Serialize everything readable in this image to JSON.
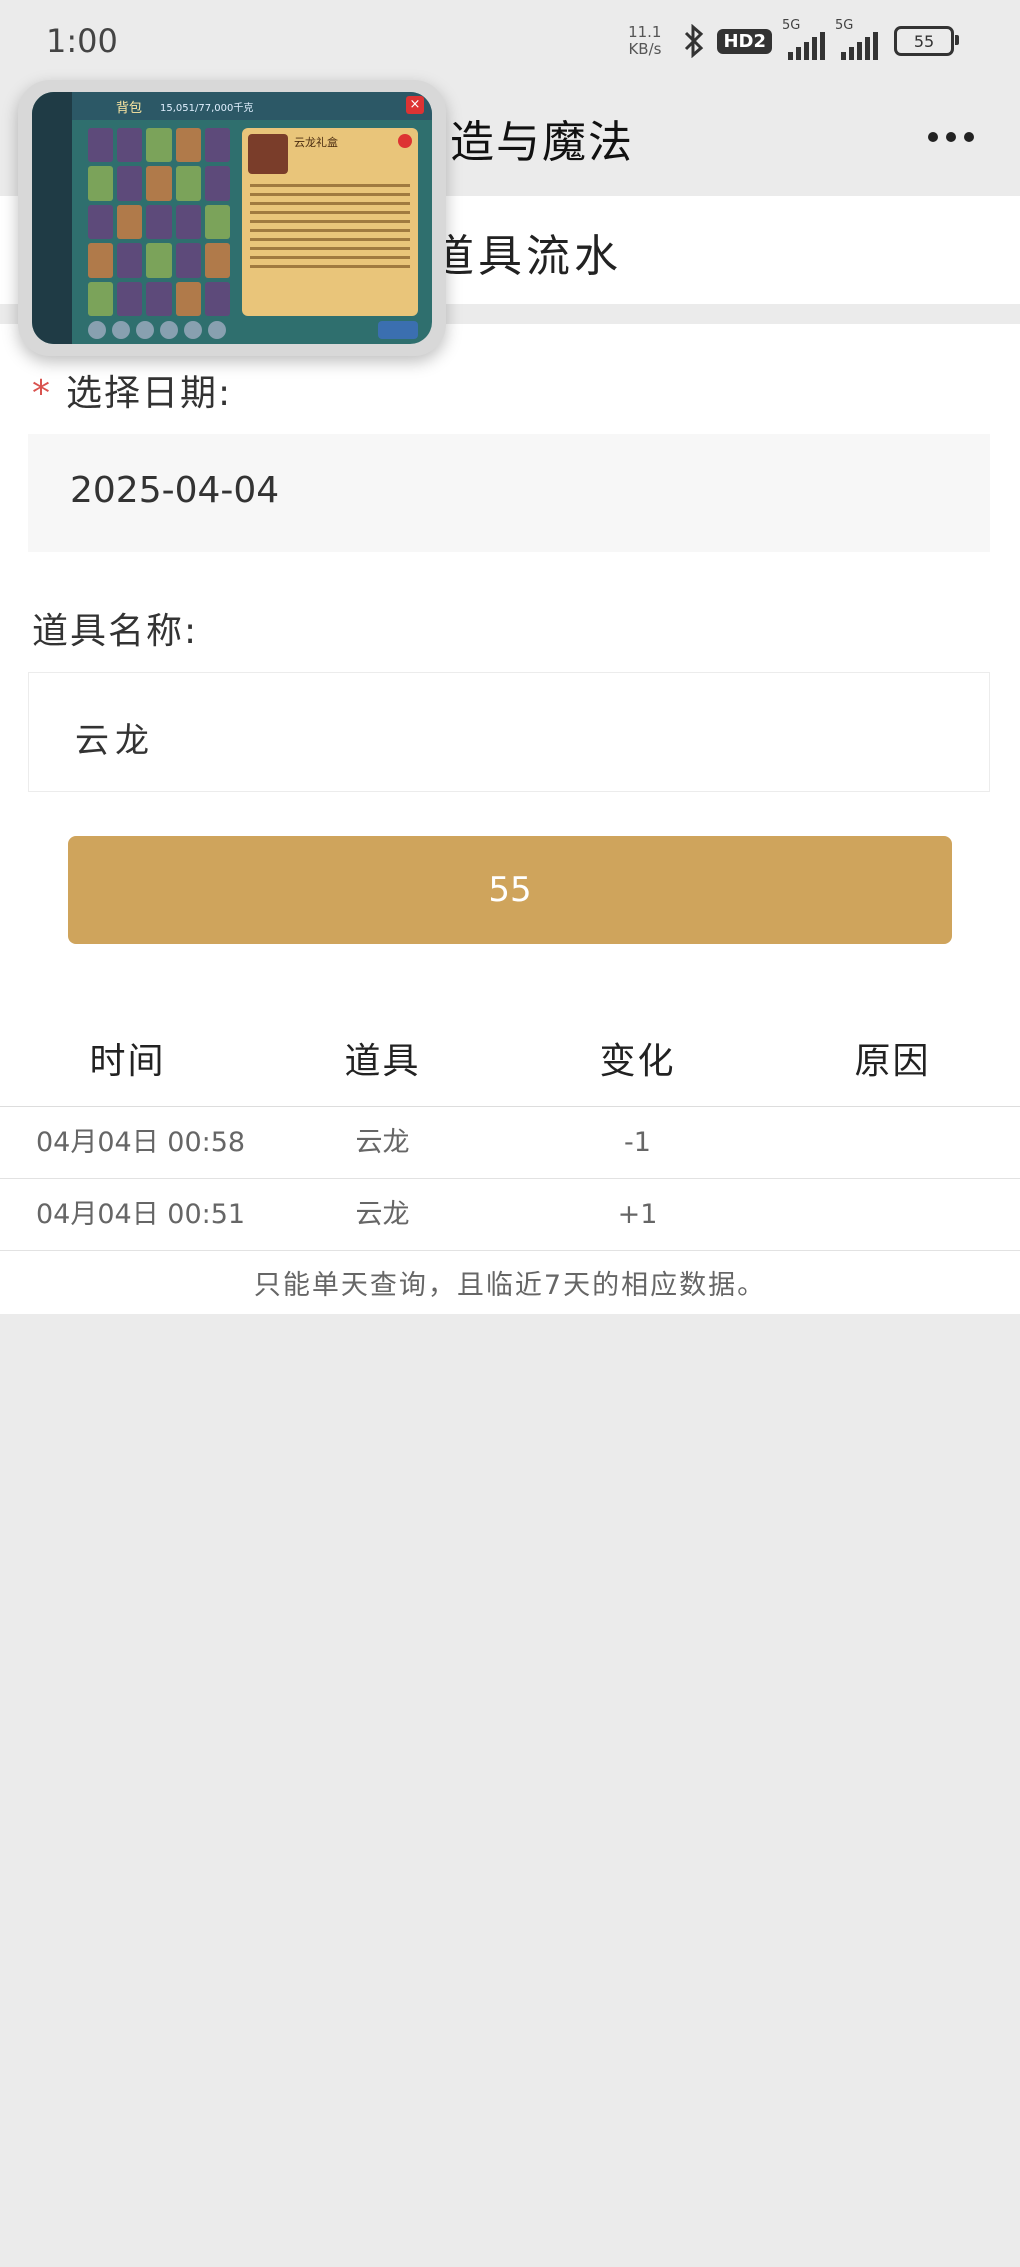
{
  "status_bar": {
    "time": "1:00",
    "net_speed_value": "11.1",
    "net_speed_unit": "KB/s",
    "hd_label": "HD2",
    "signal1_label": "5G",
    "signal2_label": "5G",
    "battery": "55"
  },
  "nav": {
    "title": "造与魔法"
  },
  "header": {
    "title": "道具流水"
  },
  "form": {
    "date_required_mark": "*",
    "date_label": "选择日期:",
    "date_value": "2025-04-04",
    "item_label": "道具名称:",
    "item_value": "云龙",
    "button_label": "55"
  },
  "table": {
    "headers": [
      "时间",
      "道具",
      "变化",
      "原因"
    ],
    "rows": [
      {
        "time": "04月04日 00:58",
        "item": "云龙",
        "change": "-1",
        "reason": ""
      },
      {
        "time": "04月04日 00:51",
        "item": "云龙",
        "change": "+1",
        "reason": ""
      }
    ],
    "note": "只能单天查询，且临近7天的相应数据。"
  },
  "pip": {
    "title": "背包",
    "capacity": "15,051/77,000千克",
    "panel_title": "云龙礼盒"
  },
  "colors": {
    "accent_button": "#cfa45c",
    "required_mark": "#d9534f",
    "background": "#ebebeb"
  }
}
